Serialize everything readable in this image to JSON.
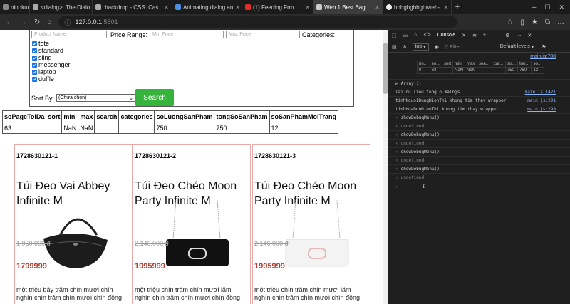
{
  "browser": {
    "tabs": [
      {
        "label": "ninokun2",
        "active": false
      },
      {
        "label": "<dialog>: The Dialo",
        "active": false
      },
      {
        "label": ":backdrop - CSS: Cas",
        "active": false
      },
      {
        "label": "Animating dialog an",
        "active": false
      },
      {
        "label": "(1) Feeding Frm",
        "active": false
      },
      {
        "label": "Web 1 Best Bag",
        "active": true
      },
      {
        "label": "bhbghghbgb/web-",
        "active": false
      }
    ],
    "url_host": "127.0.0.1",
    "url_port": ":5501"
  },
  "filters": {
    "product_name_placeholder": "Product Name",
    "price_range_label": "Price Range:",
    "min_price_placeholder": "Min Price",
    "max_price_placeholder": "Max Price",
    "categories_label": "Categories:",
    "categories": [
      "tote",
      "standard",
      "sling",
      "messenger",
      "laptop",
      "duffle"
    ],
    "sort_label": "Sort By:",
    "sort_value": "(Chưa chọn)",
    "search_button": "Search"
  },
  "debug_table": {
    "headers": [
      "soPageToiDa",
      "sort",
      "min",
      "max",
      "search",
      "categories",
      "soLuongSanPham",
      "tongSoSanPham",
      "soSanPhamMoiTrang"
    ],
    "row": [
      "63",
      "",
      "NaN",
      "NaN",
      "",
      "",
      "750",
      "750",
      "12"
    ]
  },
  "products": [
    {
      "id": "1728630121-1",
      "name": "Túi Đeo Vai Abbey Infinite M",
      "price": "1.950.000 đ",
      "sale": "1799999",
      "desc": "một triệu bảy trăm chín mươi chín nghìn chín trăm chín mươi chín đồng"
    },
    {
      "id": "1728630121-2",
      "name": "Túi Đeo Chéo Moon Party Infinite M",
      "price": "2.146.000 đ",
      "sale": "1995999",
      "desc": "một triệu chín trăm chín mươi lăm nghìn chín trăm chín mươi chín đồng"
    },
    {
      "id": "1728630121-3",
      "name": "Túi Đeo Chéo Moon Party Infinite M",
      "price": "2.146.000 đ",
      "sale": "1995999",
      "desc": "một triệu chín trăm chín mươi lăm nghìn chín trăm chín mươi chín đồng"
    }
  ],
  "devtools": {
    "tabs": [
      "</>",
      "Console"
    ],
    "context": "top",
    "filter_placeholder": "Filter",
    "levels": "Default levels",
    "table_headers": [
      "(in…",
      "so…",
      "sort",
      "min",
      "max",
      "sea…",
      "cat…",
      "so…",
      "ton…",
      "so…"
    ],
    "table_row": [
      "0",
      "63",
      "",
      "NaN",
      "NaN",
      "",
      "",
      "750",
      "750",
      "12"
    ],
    "table_source": "main.js:708",
    "array_label": "Array(1)",
    "log1": {
      "text": "Tai du lieu tong o mainjs",
      "src": "main.js:1421"
    },
    "log2": {
      "text": "tinhNguoiDungHienThi khong tim thay wrapper",
      "src": "main.js:291"
    },
    "log3": {
      "text": "tinhHoaDonHienThi khong tim thay wrapper",
      "src": "main.js:299"
    },
    "cmd": "showDebugMenu()",
    "result": "undefined"
  }
}
